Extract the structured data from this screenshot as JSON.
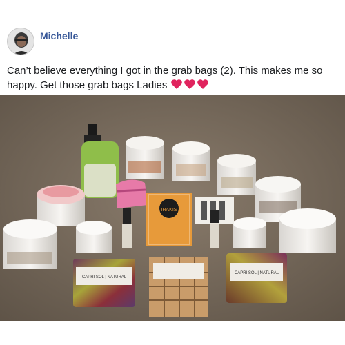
{
  "post": {
    "author": "Michelle",
    "text": "Can’t believe everything I got in the grab bags (2). This makes me so happy. Get those grab bags Ladies",
    "emoji_icon": "three-red-hearts-icon"
  },
  "photo": {
    "soap_label": "CAPRI SOL | NATURAL",
    "orange_box_brand": "IRAKIS"
  }
}
